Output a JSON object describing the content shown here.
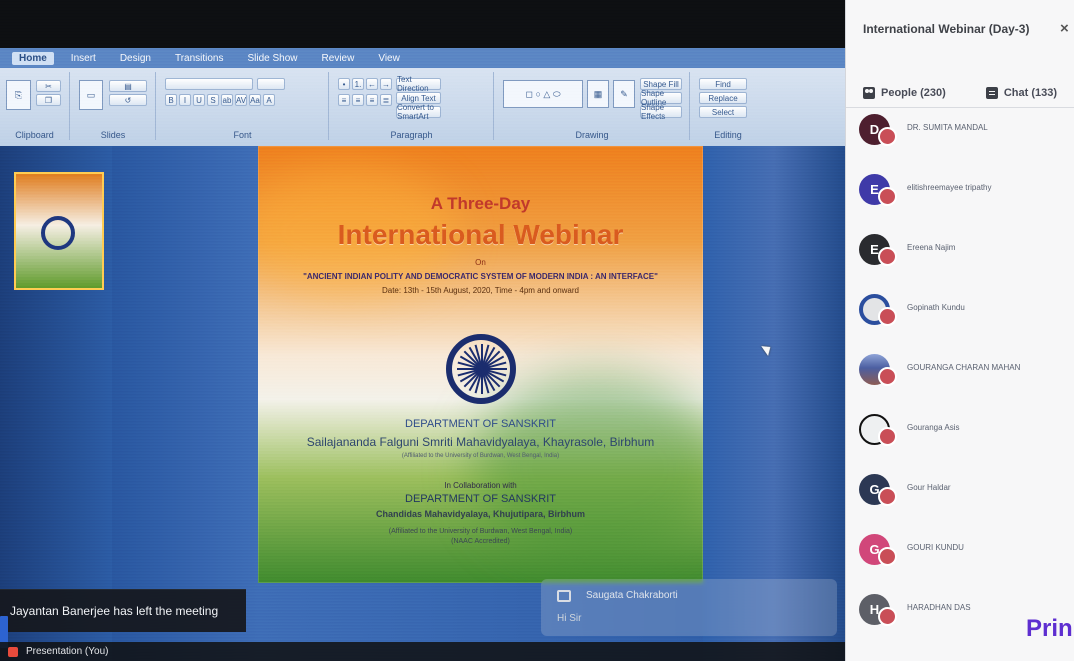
{
  "ppt": {
    "tabs": [
      "Home",
      "Insert",
      "Design",
      "Transitions",
      "Slide Show",
      "Review",
      "View"
    ],
    "groups": [
      "Clipboard",
      "Slides",
      "Font",
      "Paragraph",
      "Drawing",
      "Editing"
    ]
  },
  "slide": {
    "title_small": "A Three-Day",
    "title_big": "International Webinar",
    "on": "On",
    "topic": "\"ANCIENT INDIAN POLITY AND DEMOCRATIC SYSTEM OF MODERN INDIA : AN INTERFACE\"",
    "date": "Date: 13th - 15th August, 2020, Time - 4pm and onward",
    "dept1": "DEPARTMENT OF SANSKRIT",
    "dept2": "Sailajananda Falguni Smriti Mahavidyalaya, Khayrasole, Birbhum",
    "dept3": "(Affiliated to the University of Burdwan, West Bengal, India)",
    "dept4": "In Collaboration with",
    "dept5": "DEPARTMENT OF SANSKRIT",
    "dept6": "Chandidas Mahavidyalaya, Khujutipara, Birbhum",
    "dept7_line1": "(Affiliated to the University of Burdwan, West Bengal, India)",
    "dept7_line2": "(NAAC Accredited)"
  },
  "notification": {
    "text": "Jayantan Banerjee has left the meeting"
  },
  "chat_toast": {
    "name": "Saugata Chakraborti",
    "message": "Hi Sir"
  },
  "bottom_status": {
    "text": "Presentation (You)"
  },
  "sidebar": {
    "title": "International Webinar (Day-3)",
    "tabs": {
      "people": "People (230)",
      "chat": "Chat (133)"
    },
    "people": [
      {
        "initial": "D",
        "name": "DR. SUMITA MANDAL",
        "color": "#4e1f2f"
      },
      {
        "initial": "E",
        "name": "elitishreemayee tripathy",
        "color": "#3f3aa8"
      },
      {
        "initial": "E",
        "name": "Ereena Najim",
        "color": "#2a2b2f"
      },
      {
        "initial": "",
        "name": "Gopinath Kundu",
        "color": "#e3e4e6"
      },
      {
        "initial": "",
        "name": "GOURANGA CHARAN MAHAN",
        "color": "#b7c4d8"
      },
      {
        "initial": "",
        "name": "Gouranga Asis",
        "color": "#eef0f1"
      },
      {
        "initial": "G",
        "name": "Gour Haldar",
        "color": "#2c3854"
      },
      {
        "initial": "G",
        "name": "GOURI KUNDU",
        "color": "#d1477a"
      },
      {
        "initial": "H",
        "name": "HARADHAN DAS",
        "color": "#5d5f67"
      }
    ]
  },
  "watermark": "Prin"
}
